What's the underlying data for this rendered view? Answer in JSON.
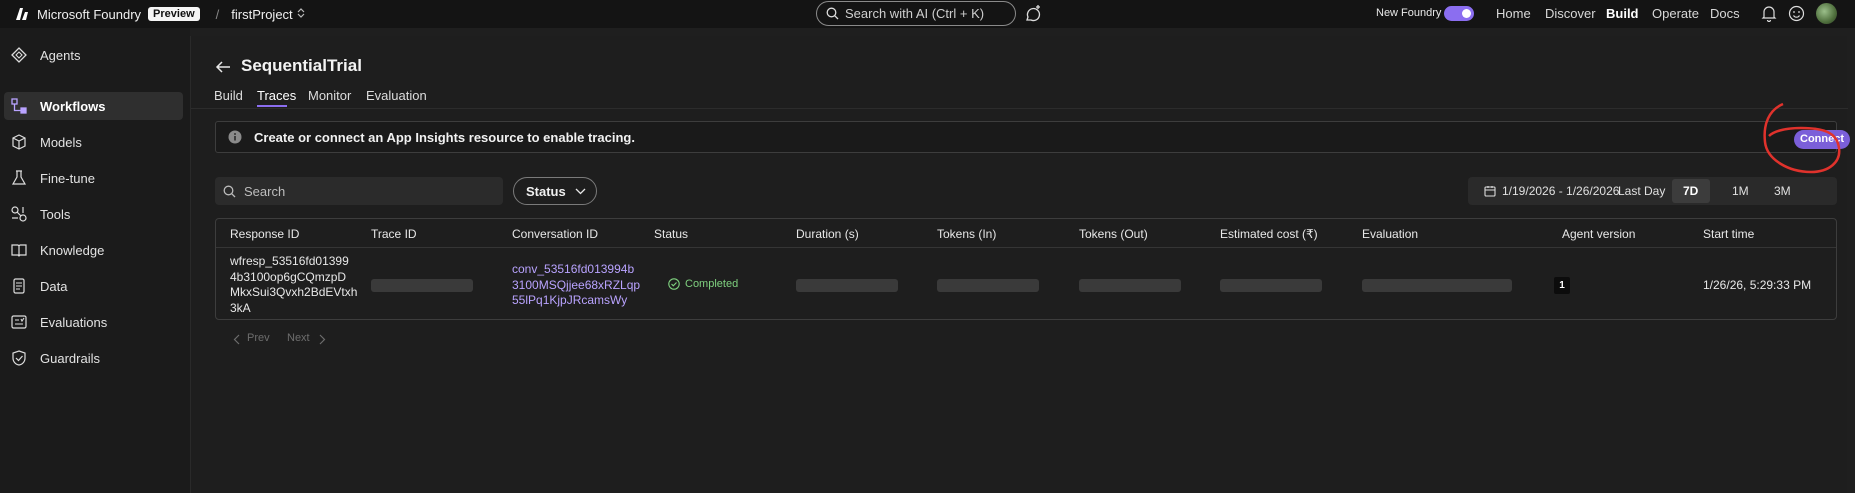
{
  "topbar": {
    "brand": "Microsoft Foundry",
    "preview_badge": "Preview",
    "separator": "/",
    "project": "firstProject",
    "search_placeholder": "Search with AI (Ctrl + K)",
    "new_foundry_label": "New Foundry",
    "nav": [
      {
        "label": "Home"
      },
      {
        "label": "Discover"
      },
      {
        "label": "Build"
      },
      {
        "label": "Operate"
      },
      {
        "label": "Docs"
      }
    ]
  },
  "sidebar": {
    "items": [
      {
        "label": "Agents",
        "icon": "agents-icon"
      },
      {
        "label": "Workflows",
        "icon": "workflow-icon"
      },
      {
        "label": "Models",
        "icon": "cube-icon"
      },
      {
        "label": "Fine-tune",
        "icon": "flask-icon"
      },
      {
        "label": "Tools",
        "icon": "tools-icon"
      },
      {
        "label": "Knowledge",
        "icon": "knowledge-icon"
      },
      {
        "label": "Data",
        "icon": "database-icon"
      },
      {
        "label": "Evaluations",
        "icon": "evaluations-icon"
      },
      {
        "label": "Guardrails",
        "icon": "shield-icon"
      }
    ]
  },
  "page": {
    "title": "SequentialTrial",
    "tabs": [
      {
        "label": "Build"
      },
      {
        "label": "Traces"
      },
      {
        "label": "Monitor"
      },
      {
        "label": "Evaluation"
      }
    ]
  },
  "banner": {
    "text": "Create or connect an App Insights resource to enable tracing.",
    "connect_label": "Connect"
  },
  "filters": {
    "search_placeholder": "Search",
    "status_label": "Status",
    "date_range": "1/19/2026 - 1/26/2026",
    "ranges": [
      {
        "label": "Last Day"
      },
      {
        "label": "7D"
      },
      {
        "label": "1M"
      },
      {
        "label": "3M"
      }
    ]
  },
  "table": {
    "columns": [
      "Response ID",
      "Trace ID",
      "Conversation ID",
      "Status",
      "Duration (s)",
      "Tokens (In)",
      "Tokens (Out)",
      "Estimated cost (₹)",
      "Evaluation",
      "Agent version",
      "Start time"
    ],
    "rows": [
      {
        "response_id_lines": [
          "wfresp_53516fd01399",
          "4b3100op6gCQmzpD",
          "MkxSui3Qvxh2BdEVtxh",
          "3kA"
        ],
        "conversation_id_lines": [
          "conv_53516fd013994b",
          "3100MSQjjee68xRZLqp",
          "55lPq1KjpJRcamsWy"
        ],
        "status": "Completed",
        "agent_version": "1",
        "start_time": "1/26/26, 5:29:33 PM"
      }
    ]
  },
  "pager": {
    "prev_label": "Prev",
    "next_label": "Next"
  },
  "colors": {
    "accent": "#8b6ef0",
    "connect_button": "#7b5fd9",
    "link": "#b9a3ff",
    "success": "#7fd17f",
    "annotation": "#e0322c"
  }
}
